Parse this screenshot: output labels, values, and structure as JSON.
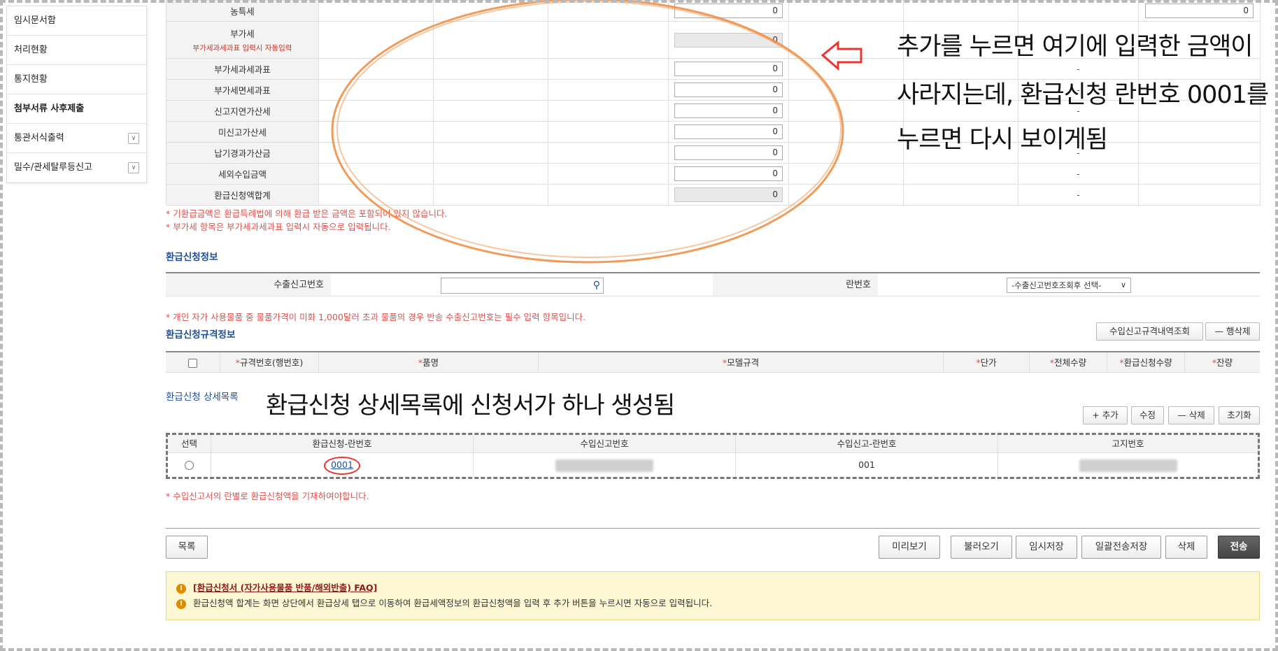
{
  "sidebar": {
    "items": [
      {
        "label": "임시문서함"
      },
      {
        "label": "처리현황"
      },
      {
        "label": "통지현황"
      },
      {
        "label": "첨부서류 사후제출"
      },
      {
        "label": "통관서식출력"
      },
      {
        "label": "밀수/관세탈루등신고"
      }
    ]
  },
  "amounts": {
    "rows": [
      {
        "label": "농특세",
        "value": "0",
        "extra_value": "0"
      },
      {
        "label": "부가세",
        "sub": "부가세과세과표 입력시 자동입력",
        "value": "0"
      },
      {
        "label": "부가세과세과표",
        "value": "0",
        "dash": "-"
      },
      {
        "label": "부가세면세과표",
        "value": "0",
        "dash": "-"
      },
      {
        "label": "신고지연가산세",
        "value": "0",
        "dash": "-"
      },
      {
        "label": "미신고가산세",
        "value": "0",
        "dash": "-"
      },
      {
        "label": "납기경과가산금",
        "value": "0",
        "dash": "-"
      },
      {
        "label": "세외수입금액",
        "value": "0",
        "dash": "-"
      },
      {
        "label": "환급신청액합계",
        "value": "0",
        "dash": "-"
      }
    ],
    "notes": [
      "* 기환급금액은 환급특례법에 의해 환급 받은 금액은 포함되어 있지 않습니다.",
      "* 부가세 항목은 부가세과세과표 입력시 자동으로 입력됩니다."
    ]
  },
  "refund_info": {
    "title": "환급신청정보",
    "export_label": "수출신고번호",
    "export_value": "",
    "line_label": "란번호",
    "line_select": "-수출신고번호조회후 선택-",
    "note": "* 개인 자가 사용물품 중 물품가격이 미화 1,000달러 초과 물품의 경우 반송 수출신고번호는 필수 입력 항목입니다."
  },
  "spec": {
    "title": "환급신청규격정보",
    "btn_lookup": "수입신고규격내역조회",
    "btn_delete_row": "— 행삭제",
    "columns": [
      "규격번호(행번호)",
      "품명",
      "모델규격",
      "단가",
      "전체수량",
      "환급신청수량",
      "잔량"
    ]
  },
  "detail": {
    "title": "환급신청 상세목록",
    "btn_add": "+ 추가",
    "btn_edit": "수정",
    "btn_delete": "— 삭제",
    "btn_reset": "초기화",
    "columns": [
      "선택",
      "환급신청-란번호",
      "수입신고번호",
      "수입신고-란번호",
      "고지번호"
    ],
    "row": {
      "line_no": "0001",
      "import_line": "001"
    },
    "note": "* 수입신고서의 란별로 환급신청액을 기재하여야합니다."
  },
  "footer": {
    "btn_list": "목록",
    "btn_preview": "미리보기",
    "btn_load": "불러오기",
    "btn_temp_save": "임시저장",
    "btn_batch_save": "일괄전송저장",
    "btn_delete": "삭제",
    "btn_send": "전송"
  },
  "faq": {
    "link": "[환급신청서 (자가사용물품 반품/해외반출) FAQ]",
    "text": "환급신청액 합계는 화면 상단에서 환급상세 탭으로 이동하여 환급세액정보의 환급신청액을 입력 후 추가 버튼을 누르시면 자동으로 입력됩니다."
  },
  "annotations": {
    "top_line1": "추가를 누르면 여기에 입력한 금액이",
    "top_line2": "사라지는데, 환급신청 란번호 0001를",
    "top_line3": "누르면 다시 보이게됨",
    "middle": "환급신청 상세목록에 신청서가 하나 생성됨"
  }
}
